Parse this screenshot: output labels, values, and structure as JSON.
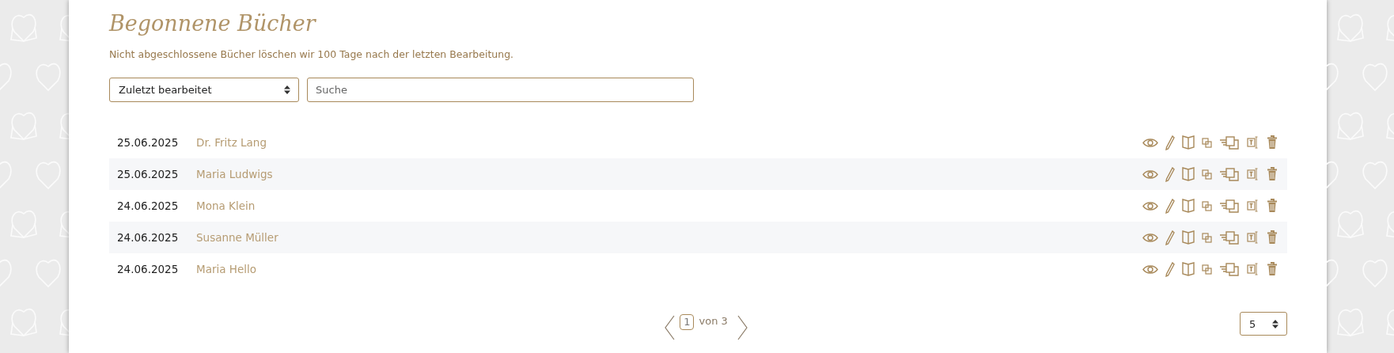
{
  "heading": "Begonnene Bücher",
  "note": "Nicht abgeschlossene Bücher löschen wir 100 Tage nach der letzten Bearbeitung.",
  "sort_select": {
    "value": "Zuletzt bearbeitet"
  },
  "search": {
    "placeholder": "Suche"
  },
  "books": [
    {
      "date": "25.06.2025",
      "title": "Dr. Fritz Lang"
    },
    {
      "date": "25.06.2025",
      "title": "Maria Ludwigs"
    },
    {
      "date": "24.06.2025",
      "title": "Mona Klein"
    },
    {
      "date": "24.06.2025",
      "title": "Susanne Müller"
    },
    {
      "date": "24.06.2025",
      "title": "Maria Hello"
    }
  ],
  "pagination": {
    "page": "1",
    "total": "von 3"
  },
  "page_size": {
    "value": "5"
  }
}
